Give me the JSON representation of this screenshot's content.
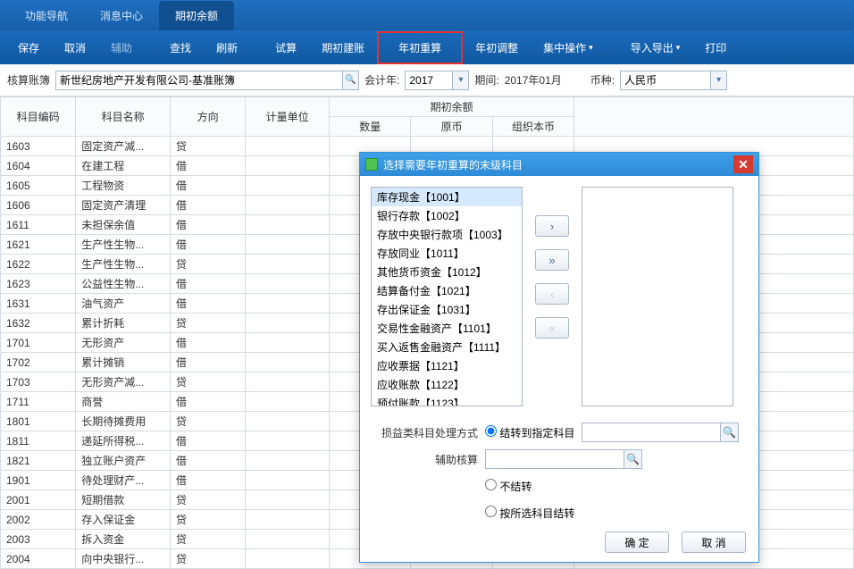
{
  "top_tabs": {
    "items": [
      "功能导航",
      "消息中心",
      "期初余额"
    ],
    "active": 2
  },
  "toolbar": {
    "save": "保存",
    "cancel": "取消",
    "aux": "辅助",
    "search": "查找",
    "refresh": "刷新",
    "trial": "试算",
    "build": "期初建账",
    "recalc": "年初重算",
    "adjust": "年初调整",
    "batch": "集中操作",
    "io": "导入导出",
    "print": "打印"
  },
  "filter": {
    "ledger_label": "核算账簿",
    "ledger_value": "新世纪房地产开发有限公司-基准账簿",
    "fy_label": "会计年:",
    "fy_value": "2017",
    "period_label": "期间:",
    "period_value": "2017年01月",
    "cur_label": "币种:",
    "cur_value": "人民币"
  },
  "grid": {
    "headers": {
      "code": "科目编码",
      "name": "科目名称",
      "dir": "方向",
      "uom": "计量单位",
      "group": "期初余额",
      "qty": "数量",
      "orig": "原币",
      "org": "组织本币"
    },
    "rows": [
      {
        "code": "1603",
        "name": "固定资产减...",
        "dir": "贷"
      },
      {
        "code": "1604",
        "name": "在建工程",
        "dir": "借"
      },
      {
        "code": "1605",
        "name": "工程物资",
        "dir": "借"
      },
      {
        "code": "1606",
        "name": "固定资产清理",
        "dir": "借"
      },
      {
        "code": "1611",
        "name": "未担保余值",
        "dir": "借"
      },
      {
        "code": "1621",
        "name": "生产性生物...",
        "dir": "借"
      },
      {
        "code": "1622",
        "name": "生产性生物...",
        "dir": "贷"
      },
      {
        "code": "1623",
        "name": "公益性生物...",
        "dir": "借"
      },
      {
        "code": "1631",
        "name": "油气资产",
        "dir": "借"
      },
      {
        "code": "1632",
        "name": "累计折耗",
        "dir": "贷"
      },
      {
        "code": "1701",
        "name": "无形资产",
        "dir": "借"
      },
      {
        "code": "1702",
        "name": "累计摊销",
        "dir": "借"
      },
      {
        "code": "1703",
        "name": "无形资产减...",
        "dir": "贷"
      },
      {
        "code": "1711",
        "name": "商誉",
        "dir": "借"
      },
      {
        "code": "1801",
        "name": "长期待摊费用",
        "dir": "贷"
      },
      {
        "code": "1811",
        "name": "递延所得税...",
        "dir": "借"
      },
      {
        "code": "1821",
        "name": "独立账户资产",
        "dir": "借"
      },
      {
        "code": "1901",
        "name": "待处理财产...",
        "dir": "借"
      },
      {
        "code": "2001",
        "name": "短期借款",
        "dir": "贷"
      },
      {
        "code": "2002",
        "name": "存入保证金",
        "dir": "贷"
      },
      {
        "code": "2003",
        "name": "拆入资金",
        "dir": "贷"
      },
      {
        "code": "2004",
        "name": "向中央银行...",
        "dir": "贷"
      }
    ]
  },
  "dialog": {
    "title": "选择需要年初重算的末级科目",
    "left_items": [
      "库存现金【1001】",
      "银行存款【1002】",
      "存放中央银行款项【1003】",
      "存放同业【1011】",
      "其他货币资金【1012】",
      "结算备付金【1021】",
      "存出保证金【1031】",
      "交易性金融资产【1101】",
      "买入返售金融资产【1111】",
      "应收票据【1121】",
      "应收账款【1122】",
      "预付账款【1123】"
    ],
    "move_right": "›",
    "move_all_right": "»",
    "move_left": "‹",
    "move_all_left": "«",
    "opt_label": "损益类科目处理方式",
    "opt_transfer": "结转到指定科目",
    "opt_aux": "辅助核算",
    "opt_none": "不结转",
    "opt_bysel": "按所选科目结转",
    "ok": "确 定",
    "cancel": "取 消"
  }
}
